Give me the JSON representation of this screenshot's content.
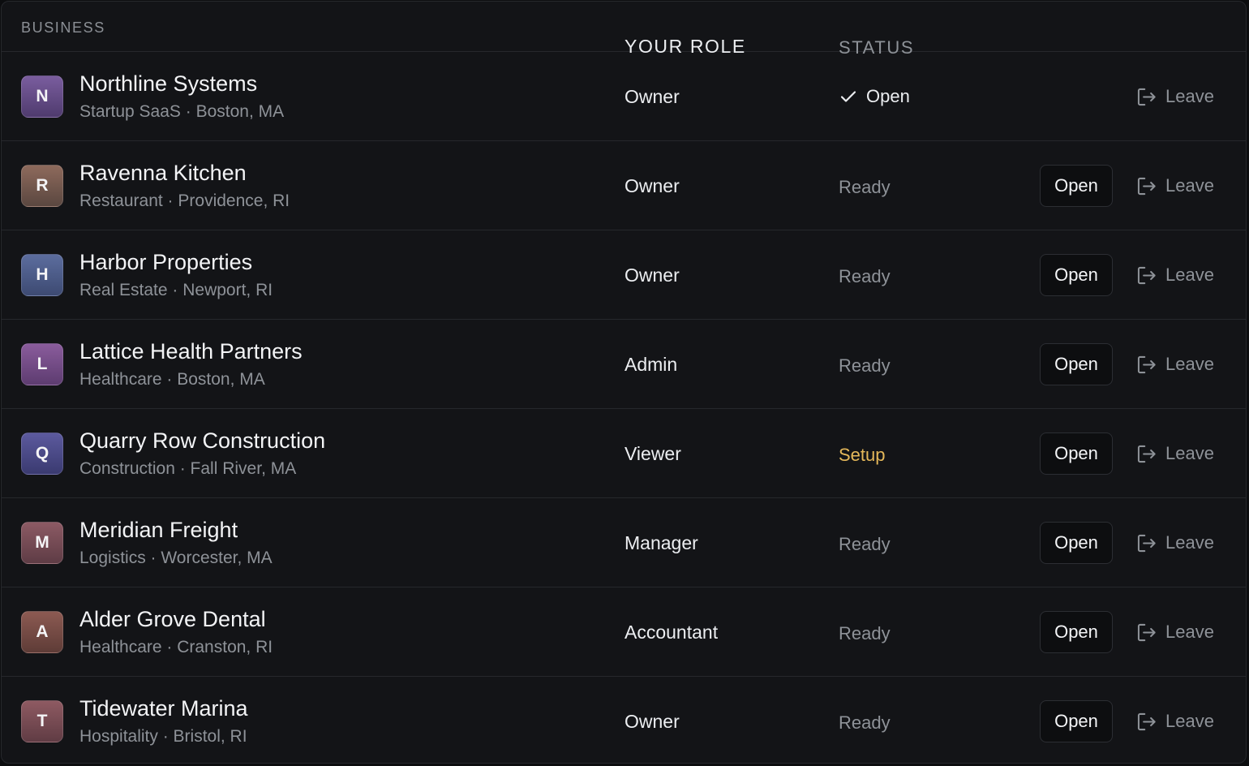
{
  "headers": {
    "business": "BUSINESS",
    "role": "YOUR ROLE",
    "status": "STATUS"
  },
  "actions": {
    "open_label": "Open",
    "leave_label": "Leave"
  },
  "rows": [
    {
      "initial": "N",
      "name": "Northline Systems",
      "meta": "Startup SaaS · Boston, MA",
      "role": "Owner",
      "status": "Open",
      "state": "current",
      "gradient": [
        "#7a5d9e",
        "#4f3b6e"
      ]
    },
    {
      "initial": "R",
      "name": "Ravenna Kitchen",
      "meta": "Restaurant · Providence, RI",
      "role": "Owner",
      "status": "Ready",
      "state": "ready",
      "gradient": [
        "#8e6a5c",
        "#5a4740"
      ]
    },
    {
      "initial": "H",
      "name": "Harbor Properties",
      "meta": "Real Estate · Newport, RI",
      "role": "Owner",
      "status": "Ready",
      "state": "ready",
      "gradient": [
        "#5c6d9e",
        "#3d4a72"
      ]
    },
    {
      "initial": "L",
      "name": "Lattice Health Partners",
      "meta": "Healthcare · Boston, MA",
      "role": "Admin",
      "status": "Ready",
      "state": "ready",
      "gradient": [
        "#8a5c9c",
        "#5d3c70"
      ]
    },
    {
      "initial": "Q",
      "name": "Quarry Row Construction",
      "meta": "Construction · Fall River, MA",
      "role": "Viewer",
      "status": "Setup",
      "state": "setup",
      "gradient": [
        "#5c5a9e",
        "#3a3a70"
      ]
    },
    {
      "initial": "M",
      "name": "Meridian Freight",
      "meta": "Logistics · Worcester, MA",
      "role": "Manager",
      "status": "Ready",
      "state": "ready",
      "gradient": [
        "#8c5a64",
        "#5e3c45"
      ]
    },
    {
      "initial": "A",
      "name": "Alder Grove Dental",
      "meta": "Healthcare · Cranston, RI",
      "role": "Accountant",
      "status": "Ready",
      "state": "ready",
      "gradient": [
        "#8c5a52",
        "#5e3c37"
      ]
    },
    {
      "initial": "T",
      "name": "Tidewater Marina",
      "meta": "Hospitality · Bristol, RI",
      "role": "Owner",
      "status": "Ready",
      "state": "ready",
      "gradient": [
        "#8e5a62",
        "#603c44"
      ]
    }
  ]
}
